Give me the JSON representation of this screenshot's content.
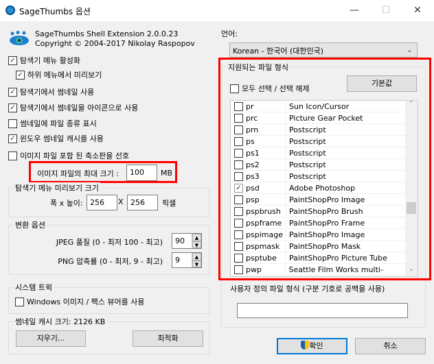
{
  "window": {
    "title": "SageThumbs 옵션",
    "minimize": "—",
    "maximize": "☐",
    "close": "✕"
  },
  "about": {
    "name": "SageThumbs Shell Extension 2.0.0.23",
    "copyright": "Copyright © 2004-2017 Nikolay Raspopov"
  },
  "options": [
    {
      "label": "탐색기 메뉴 활성화",
      "checked": true
    },
    {
      "label": "하위 메뉴에서 미리보기",
      "checked": true
    },
    {
      "label": "탐색기에서 썸네일 사용",
      "checked": true
    },
    {
      "label": "탐색기에서 썸네일을 아이콘으로 사용",
      "checked": true
    },
    {
      "label": "썸네일에 파일 종류 표시",
      "checked": false
    },
    {
      "label": "윈도우 썸네일 캐시를 사용",
      "checked": true
    },
    {
      "label": "이미지 파일 포함 된 축소판을 선호",
      "checked": false
    }
  ],
  "max_size": {
    "label": "이미지 파일의 최대 크기 :",
    "value": "100",
    "unit": "MB"
  },
  "preview": {
    "title": "탐색기 메뉴 미리보기 크기",
    "label": "폭 x 높이:",
    "width": "256",
    "sep": "X",
    "height": "256",
    "unit": "픽셀"
  },
  "convert": {
    "title": "변환 옵션",
    "jpeg_label": "JPEG 품질 (0 - 최저 100 - 최고)",
    "jpeg_value": "90",
    "png_label": "PNG 압축률 (0 - 최저, 9 - 최고)",
    "png_value": "9"
  },
  "tweak": {
    "title": "시스템 트윅",
    "viewer_label": "Windows 이미지 / 팩스 뷰어를 사용"
  },
  "cache": {
    "title": "썸네일 캐시 크기: 2126 KB",
    "clear": "지우기...",
    "optimize": "최적화"
  },
  "language": {
    "label": "언어:",
    "value": "Korean - 한국어 (대한민국)"
  },
  "formats": {
    "title": "지원되는 파일 형식",
    "select_all": "모두 선택 / 선택 해제",
    "default": "기본값",
    "rows": [
      {
        "ext": "pr",
        "desc": "Sun Icon/Cursor",
        "checked": false
      },
      {
        "ext": "prc",
        "desc": "Picture Gear Pocket",
        "checked": false
      },
      {
        "ext": "prn",
        "desc": "Postscript",
        "checked": false
      },
      {
        "ext": "ps",
        "desc": "Postscript",
        "checked": false
      },
      {
        "ext": "ps1",
        "desc": "Postscript",
        "checked": false
      },
      {
        "ext": "ps2",
        "desc": "Postscript",
        "checked": false
      },
      {
        "ext": "ps3",
        "desc": "Postscript",
        "checked": false
      },
      {
        "ext": "psd",
        "desc": "Adobe Photoshop",
        "checked": true
      },
      {
        "ext": "psp",
        "desc": "PaintShopPro Image",
        "checked": false
      },
      {
        "ext": "pspbrush",
        "desc": "PaintShopPro Brush",
        "checked": false
      },
      {
        "ext": "pspframe",
        "desc": "PaintShopPro Frame",
        "checked": false
      },
      {
        "ext": "pspimage",
        "desc": "PaintShopPro Image",
        "checked": false
      },
      {
        "ext": "pspmask",
        "desc": "PaintShopPro Mask",
        "checked": false
      },
      {
        "ext": "psptube",
        "desc": "PaintShopPro Picture Tube",
        "checked": false
      },
      {
        "ext": "pwp",
        "desc": "Seattle Film Works multi-image",
        "checked": false
      }
    ],
    "custom_label": "사용자 정의 파일 형식 (구분 기호로 공백을 사용)",
    "custom_value": ""
  },
  "buttons": {
    "ok": "확인",
    "cancel": "취소"
  }
}
